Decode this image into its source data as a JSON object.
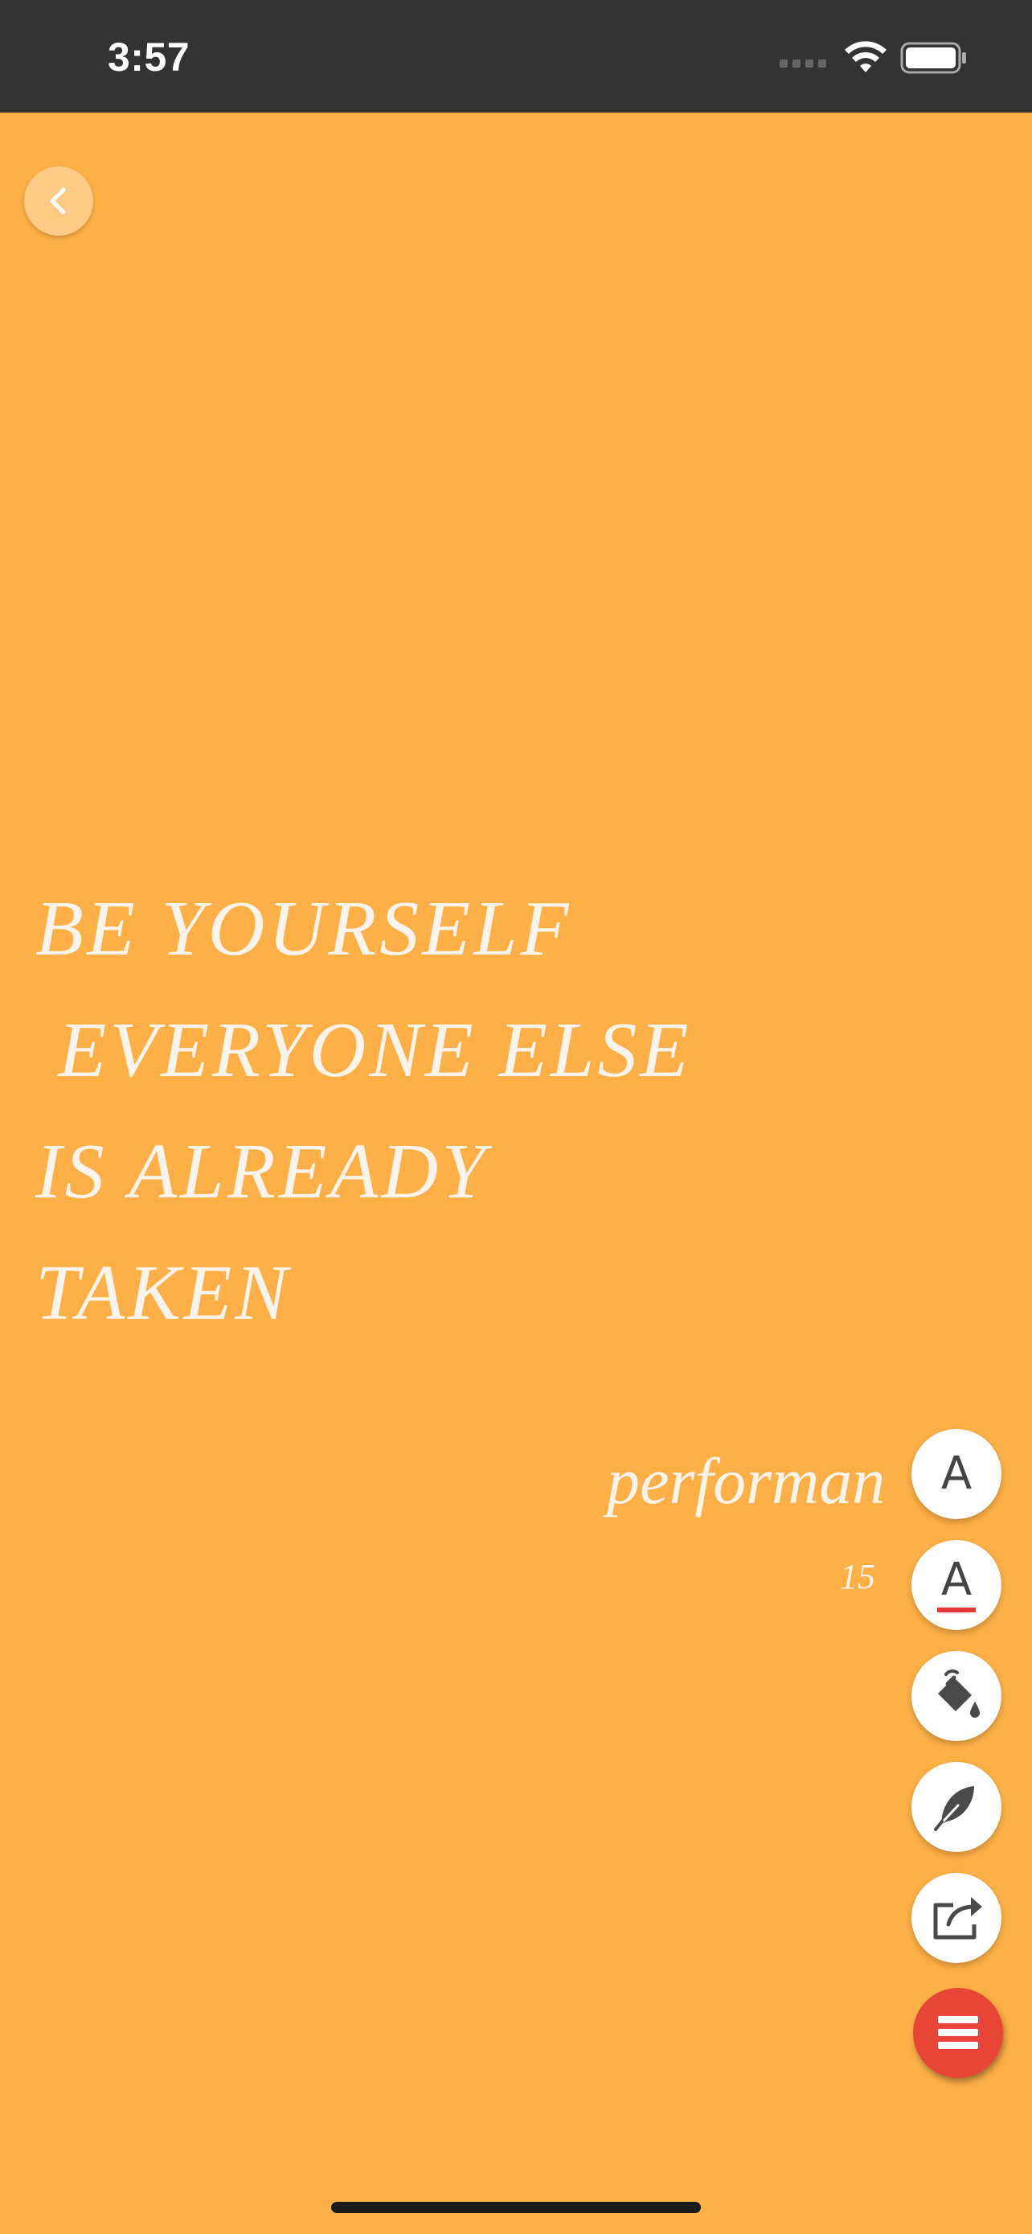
{
  "status_bar": {
    "time": "3:57",
    "icons": [
      "cellular-signal-icon",
      "wifi-icon",
      "battery-icon"
    ]
  },
  "colors": {
    "background": "#FEB047",
    "status_bar": "#333333",
    "text": "#FBF4EC",
    "menu_button": "#E74536",
    "color_underline": "#E53935"
  },
  "quote": {
    "text": "BE YOURSELF\n EVERYONE ELSE\nIS ALREADY\nTAKEN",
    "author": "performan",
    "meta": "15 "
  },
  "toolbar": {
    "font_button_glyph": "A",
    "text_color_button_glyph": "A",
    "buttons": [
      "font-button",
      "text-color-button",
      "background-fill-button",
      "signature-button",
      "share-button",
      "menu-button"
    ]
  }
}
